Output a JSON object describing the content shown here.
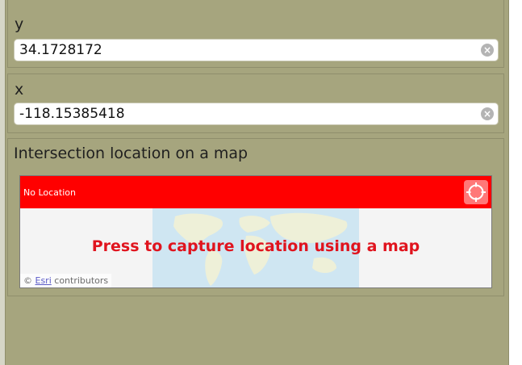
{
  "form": {
    "y_field": {
      "label": "y",
      "value": "34.1728172"
    },
    "x_field": {
      "label": "x",
      "value": "-118.15385418"
    },
    "map_field": {
      "label": "Intersection location on a map",
      "status": "No Location",
      "prompt": "Press to capture location using a map",
      "attribution": {
        "copyright": "©",
        "provider": "Esri",
        "rest": "contributors"
      }
    }
  },
  "icons": {
    "clear": "clear-circle-icon",
    "locate": "crosshair-icon"
  },
  "colors": {
    "background": "#a6a57e",
    "map_bar": "#ff0000",
    "prompt_text": "#e0141e"
  }
}
